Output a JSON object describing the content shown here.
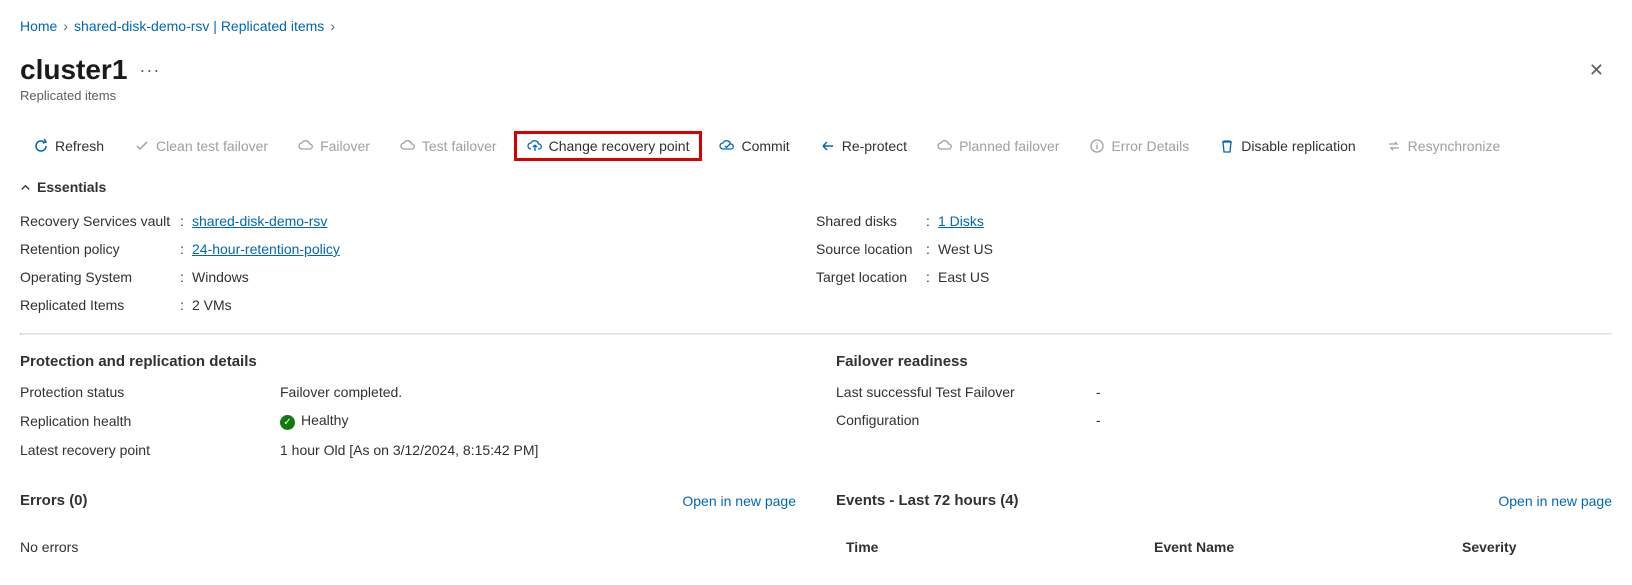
{
  "breadcrumb": {
    "home": "Home",
    "vault": "shared-disk-demo-rsv | Replicated items"
  },
  "title": "cluster1",
  "subtitle": "Replicated items",
  "toolbar": {
    "refresh": "Refresh",
    "clean": "Clean test failover",
    "failover": "Failover",
    "test_failover": "Test failover",
    "change_rp": "Change recovery point",
    "commit": "Commit",
    "reprotect": "Re-protect",
    "planned": "Planned failover",
    "error_details": "Error Details",
    "disable": "Disable replication",
    "resync": "Resynchronize"
  },
  "essentials_label": "Essentials",
  "essentials": {
    "left": {
      "rsv_label": "Recovery Services vault",
      "rsv_value": "shared-disk-demo-rsv",
      "retention_label": "Retention policy",
      "retention_value": "24-hour-retention-policy",
      "os_label": "Operating System",
      "os_value": "Windows",
      "ri_label": "Replicated Items",
      "ri_value": "2 VMs"
    },
    "right": {
      "shared_label": "Shared disks",
      "shared_value": "1 Disks",
      "src_label": "Source location",
      "src_value": "West US",
      "tgt_label": "Target location",
      "tgt_value": "East US"
    }
  },
  "protection": {
    "heading": "Protection and replication details",
    "status_label": "Protection status",
    "status_value": "Failover completed.",
    "rep_label": "Replication health",
    "rep_value": "Healthy",
    "lrp_label": "Latest recovery point",
    "lrp_value": "1 hour Old [As on 3/12/2024, 8:15:42 PM]"
  },
  "failover": {
    "heading": "Failover readiness",
    "ltf_label": "Last successful Test Failover",
    "ltf_value": "-",
    "cfg_label": "Configuration",
    "cfg_value": "-"
  },
  "errors": {
    "heading": "Errors (0)",
    "open": "Open in new page",
    "none": "No errors"
  },
  "events": {
    "heading": "Events - Last 72 hours (4)",
    "open": "Open in new page",
    "cols": {
      "time": "Time",
      "name": "Event Name",
      "sev": "Severity"
    }
  }
}
